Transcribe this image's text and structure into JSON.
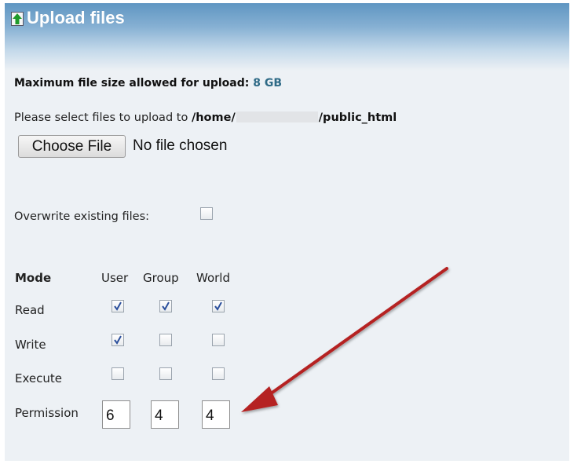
{
  "header": {
    "title": "Upload files",
    "icon": "up-arrow-icon"
  },
  "max_size": {
    "label": "Maximum file size allowed for upload:",
    "value": "8 GB"
  },
  "destination": {
    "prefix": "Please select files to upload to",
    "path_start": "/home/",
    "path_end": "/public_html"
  },
  "file_input": {
    "button_label": "Choose File",
    "status": "No file chosen"
  },
  "overwrite": {
    "label": "Overwrite existing files:",
    "checked": false
  },
  "permissions": {
    "mode_label": "Mode",
    "columns": [
      "User",
      "Group",
      "World"
    ],
    "rows": [
      {
        "label": "Read",
        "checked": [
          true,
          true,
          true
        ]
      },
      {
        "label": "Write",
        "checked": [
          true,
          false,
          false
        ]
      },
      {
        "label": "Execute",
        "checked": [
          false,
          false,
          false
        ]
      }
    ],
    "permission_label": "Permission",
    "values": [
      "6",
      "4",
      "4"
    ]
  },
  "colors": {
    "accent_value": "#2e6a86",
    "arrow": "#b52020",
    "check": "#2b4f9c"
  }
}
